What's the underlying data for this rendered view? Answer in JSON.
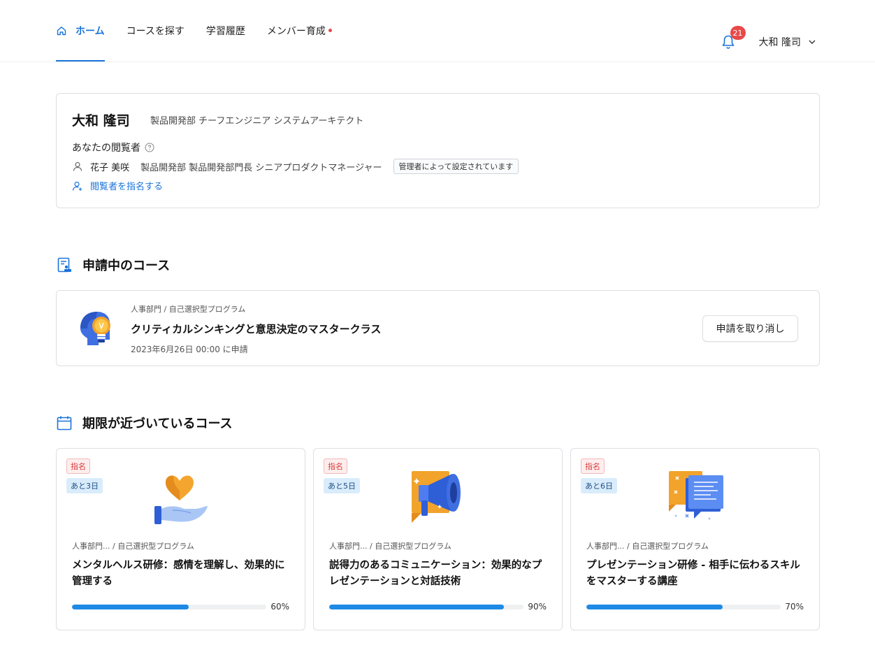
{
  "nav": {
    "items": [
      {
        "label": "ホーム",
        "active": true,
        "icon": "home-icon"
      },
      {
        "label": "コースを探す"
      },
      {
        "label": "学習履歴"
      },
      {
        "label": "メンバー育成",
        "dot": true
      }
    ],
    "notification_count": "21",
    "user_name": "大和 隆司"
  },
  "profile": {
    "name": "大和 隆司",
    "meta": "製品開発部  チーフエンジニア  システムアーキテクト",
    "viewer_title": "あなたの閲覧者",
    "viewer_name": "花子 美咲",
    "viewer_dept": "製品開発部  製品開発部門長  シニアプロダクトマネージャー",
    "admin_badge": "管理者によって設定されています",
    "assign_link": "閲覧者を指名する"
  },
  "applied_section": {
    "title": "申請中のコース",
    "course": {
      "category": "人事部門 / 自己選択型プログラム",
      "title": "クリティカルシンキングと意思決定のマスタークラス",
      "date": "2023年6月26日 00:00 に申請",
      "cancel_label": "申請を取り消し"
    }
  },
  "deadline_section": {
    "title": "期限が近づいているコース",
    "cards": [
      {
        "tag": "指名",
        "days": "あと3日",
        "category": "人事部門... / 自己選択型プログラム",
        "title": "メンタルヘルス研修：感情を理解し、効果的に管理する",
        "progress": 60,
        "progress_label": "60%",
        "icon": "heart-hand-icon"
      },
      {
        "tag": "指名",
        "days": "あと5日",
        "category": "人事部門... / 自己選択型プログラム",
        "title": "説得力のあるコミュニケーション：効果的なプレゼンテーションと対話技術",
        "progress": 90,
        "progress_label": "90%",
        "icon": "megaphone-icon"
      },
      {
        "tag": "指名",
        "days": "あと6日",
        "category": "人事部門... / 自己選択型プログラム",
        "title": "プレゼンテーション研修 - 相手に伝わるスキルをマスターする講座",
        "progress": 70,
        "progress_label": "70%",
        "icon": "chat-bubbles-icon"
      }
    ]
  },
  "colors": {
    "accent": "#1a73d9",
    "progress": "#1e8ae6",
    "alert": "#e84a4a"
  }
}
